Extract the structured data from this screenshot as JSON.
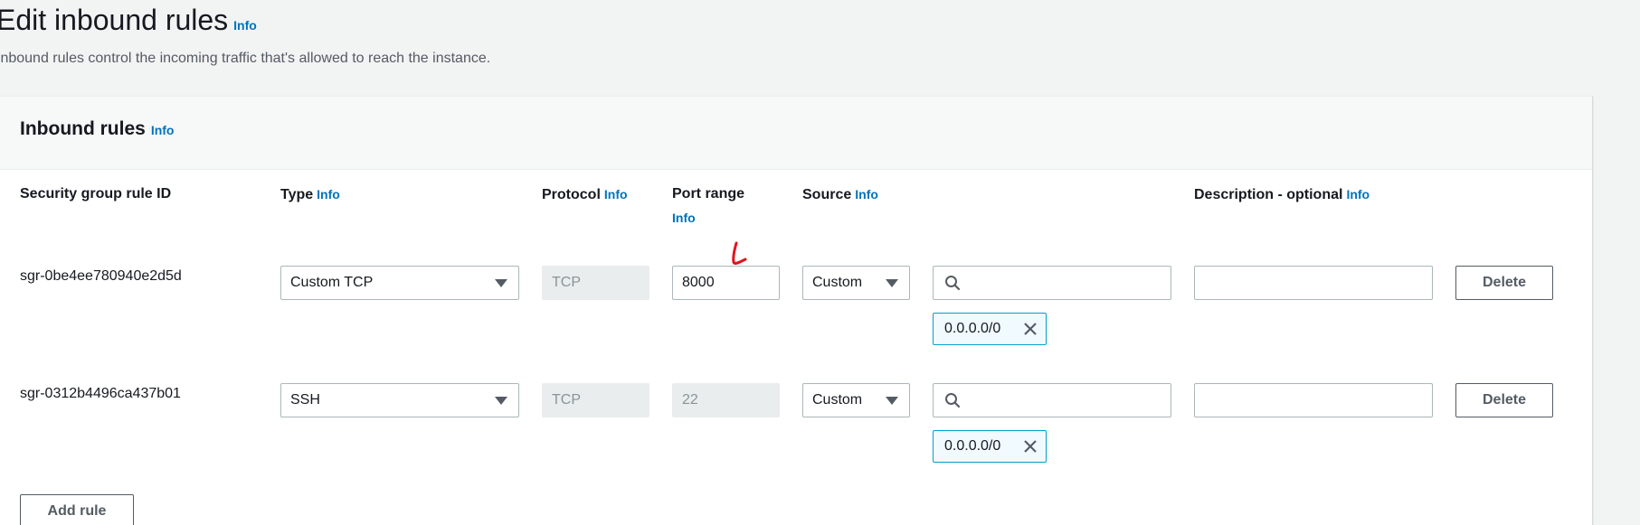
{
  "page": {
    "title": "Edit inbound rules",
    "title_info": "Info",
    "description": "Inbound rules control the incoming traffic that's allowed to reach the instance."
  },
  "panel": {
    "title": "Inbound rules",
    "title_info": "Info"
  },
  "columns": {
    "rule_id": "Security group rule ID",
    "type": "Type",
    "type_info": "Info",
    "protocol": "Protocol",
    "protocol_info": "Info",
    "port_range": "Port range",
    "port_range_info": "Info",
    "source": "Source",
    "source_info": "Info",
    "description": "Description - optional",
    "description_info": "Info"
  },
  "rules": [
    {
      "id": "sgr-0be4ee780940e2d5d",
      "type": "Custom TCP",
      "protocol": "TCP",
      "port_range": "8000",
      "port_editable": true,
      "source": "Custom",
      "source_search": "",
      "cidr": "0.0.0.0/0",
      "description": "",
      "delete_label": "Delete"
    },
    {
      "id": "sgr-0312b4496ca437b01",
      "type": "SSH",
      "protocol": "TCP",
      "port_range": "22",
      "port_editable": false,
      "source": "Custom",
      "source_search": "",
      "cidr": "0.0.0.0/0",
      "description": "",
      "delete_label": "Delete"
    }
  ],
  "add_rule_label": "Add rule",
  "colors": {
    "link": "#0073bb",
    "token_border": "#00a1c9",
    "annotation": "#e0141e"
  }
}
